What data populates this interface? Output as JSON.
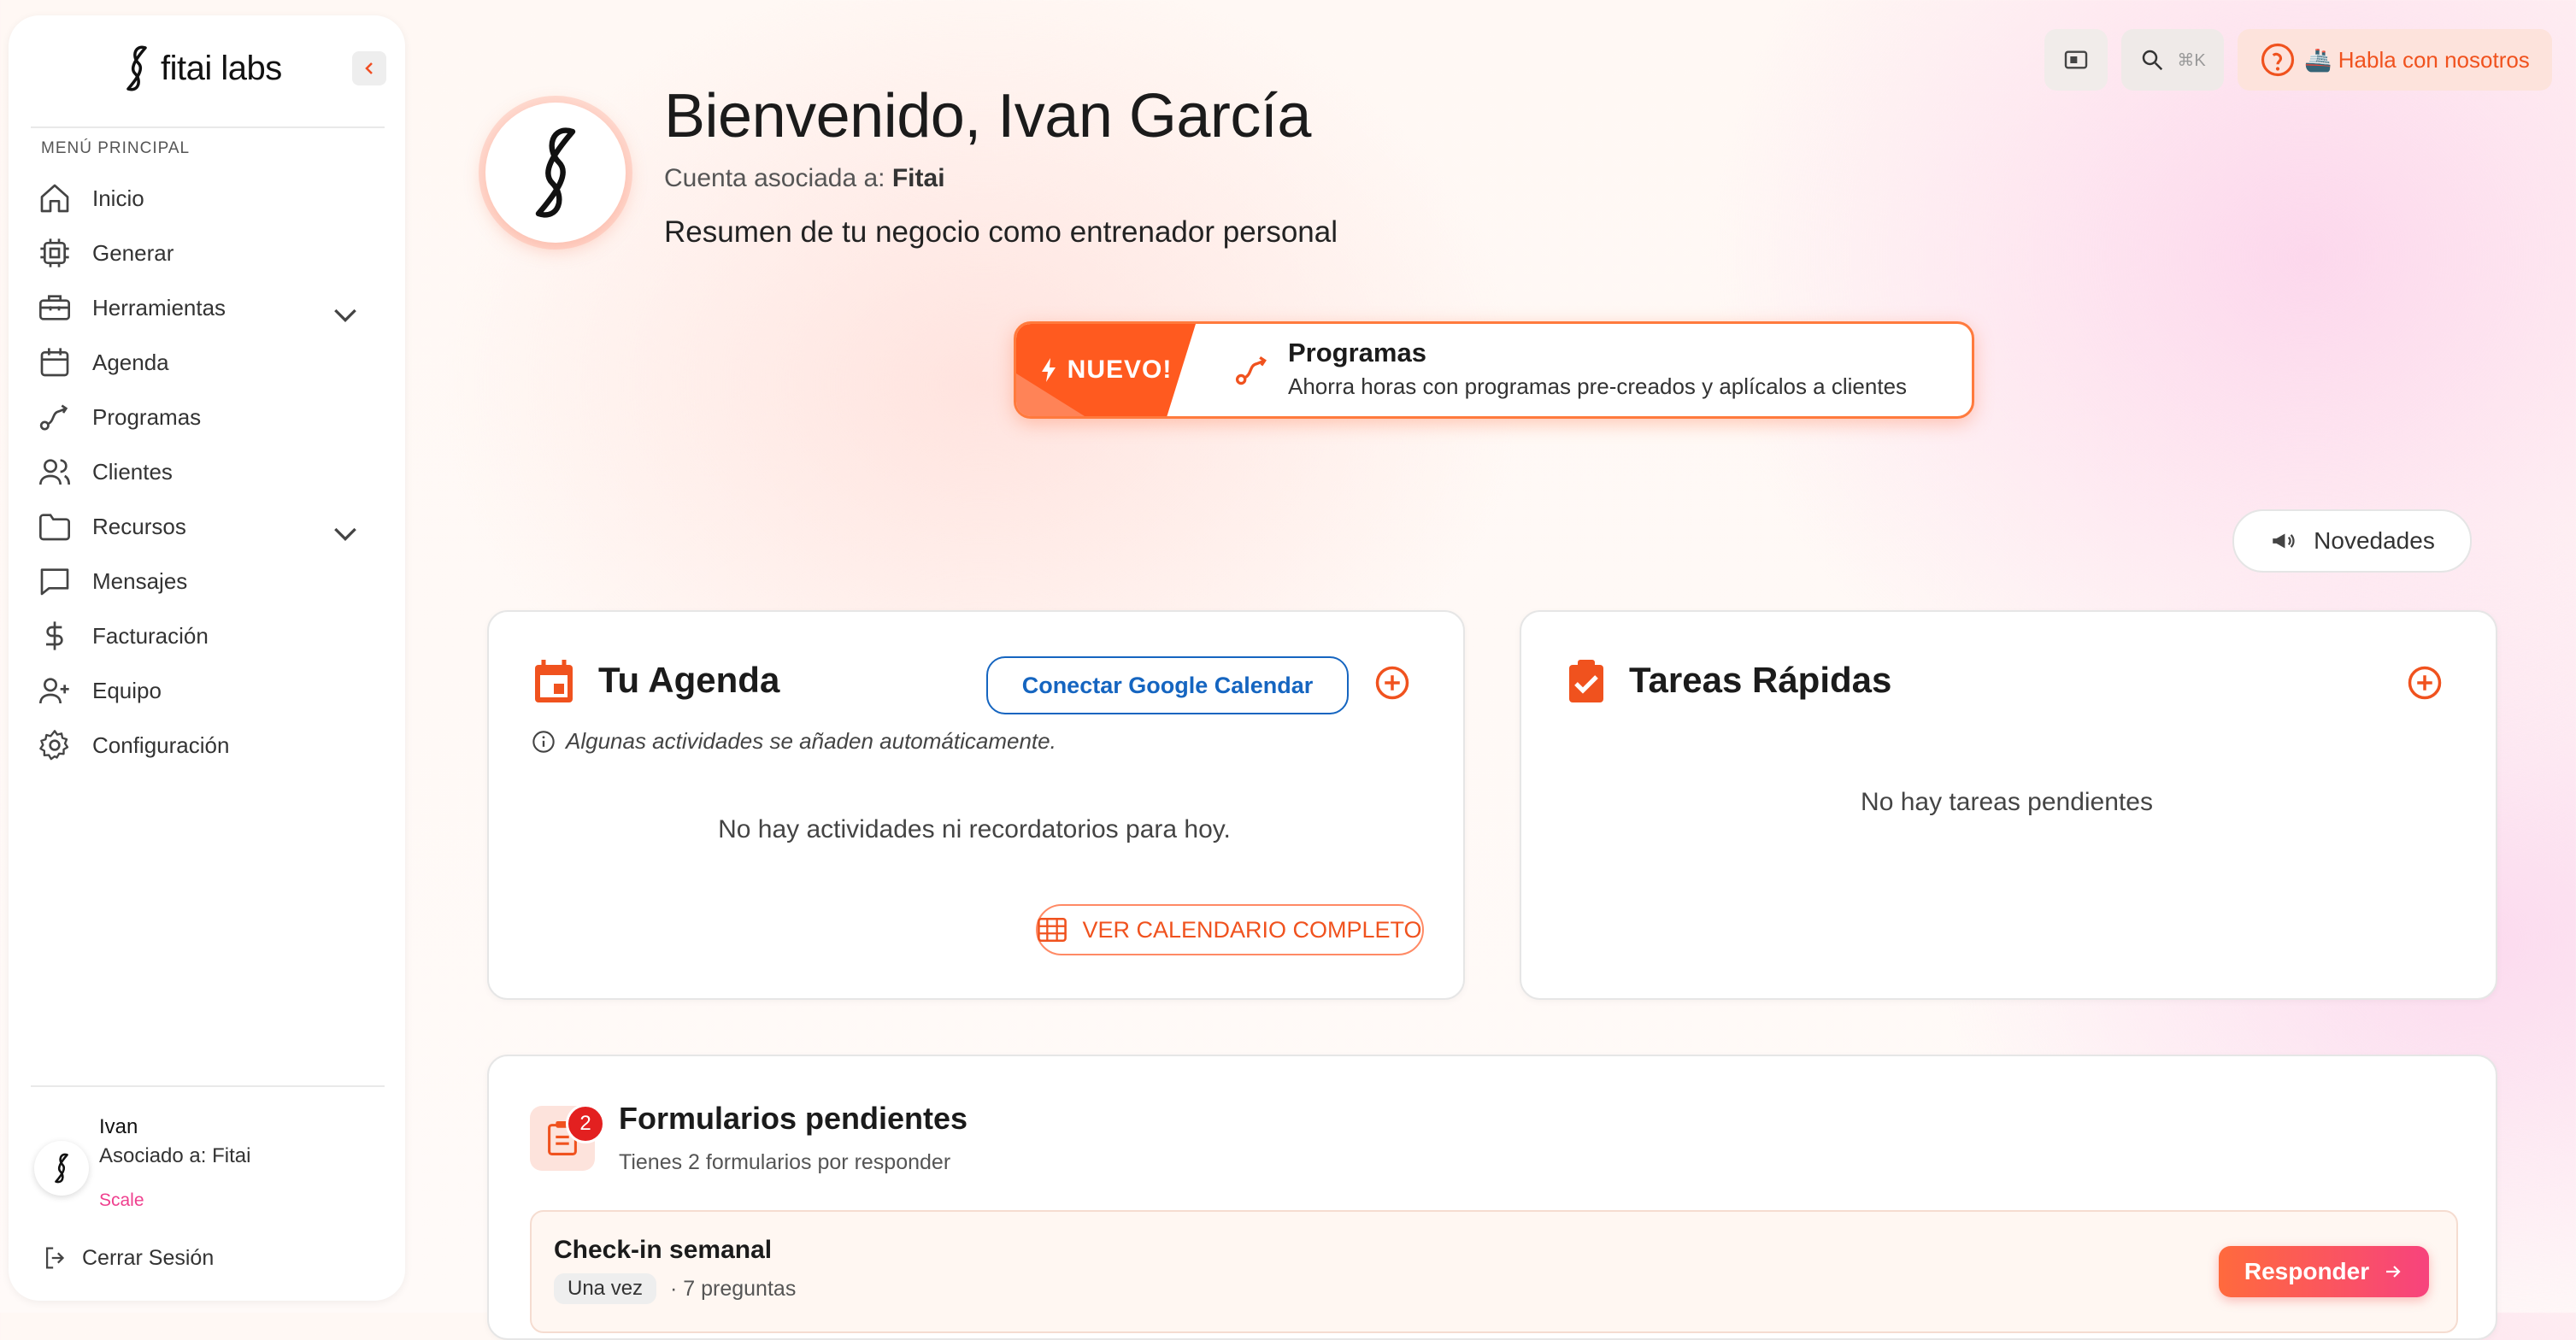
{
  "brand": {
    "name": "fitai labs"
  },
  "sidebar": {
    "section_label": "MENÚ PRINCIPAL",
    "items": [
      {
        "label": "Inicio",
        "icon": "home-icon"
      },
      {
        "label": "Generar",
        "icon": "chip-icon"
      },
      {
        "label": "Herramientas",
        "icon": "toolbox-icon",
        "expandable": true
      },
      {
        "label": "Agenda",
        "icon": "calendar-icon"
      },
      {
        "label": "Programas",
        "icon": "route-icon"
      },
      {
        "label": "Clientes",
        "icon": "users-icon"
      },
      {
        "label": "Recursos",
        "icon": "folder-icon",
        "expandable": true
      },
      {
        "label": "Mensajes",
        "icon": "message-icon"
      },
      {
        "label": "Facturación",
        "icon": "dollar-icon"
      },
      {
        "label": "Equipo",
        "icon": "user-plus-icon"
      },
      {
        "label": "Configuración",
        "icon": "gear-icon"
      }
    ],
    "user": {
      "name": "Ivan",
      "association": "Asociado a: Fitai",
      "plan": "Scale"
    },
    "logout_label": "Cerrar Sesión"
  },
  "topbar": {
    "search_shortcut": "⌘K",
    "talk_label": "🚢 Habla con nosotros"
  },
  "header": {
    "welcome": "Bienvenido, Ivan García",
    "account_prefix": "Cuenta asociada a:",
    "account_name": "Fitai",
    "summary": "Resumen de tu negocio como entrenador personal"
  },
  "promo": {
    "tag": "NUEVO!",
    "title": "Programas",
    "subtitle": "Ahorra horas con programas pre-creados y aplícalos a clientes"
  },
  "news_button": "Novedades",
  "agenda": {
    "title": "Tu Agenda",
    "connect_label": "Conectar Google Calendar",
    "info": "Algunas actividades se añaden automáticamente.",
    "empty": "No hay actividades ni recordatorios para hoy.",
    "calendar_button": "VER CALENDARIO COMPLETO"
  },
  "tasks": {
    "title": "Tareas Rápidas",
    "empty": "No hay tareas pendientes"
  },
  "forms": {
    "badge": "2",
    "title": "Formularios pendientes",
    "subtitle": "Tienes 2 formularios por responder",
    "items": [
      {
        "name": "Check-in semanal",
        "frequency": "Una vez",
        "meta": "· 7 preguntas",
        "action": "Responder"
      }
    ]
  },
  "colors": {
    "accent": "#f0521e",
    "link": "#1565c0",
    "badge": "#e32020",
    "plan": "#ef3f8e"
  }
}
